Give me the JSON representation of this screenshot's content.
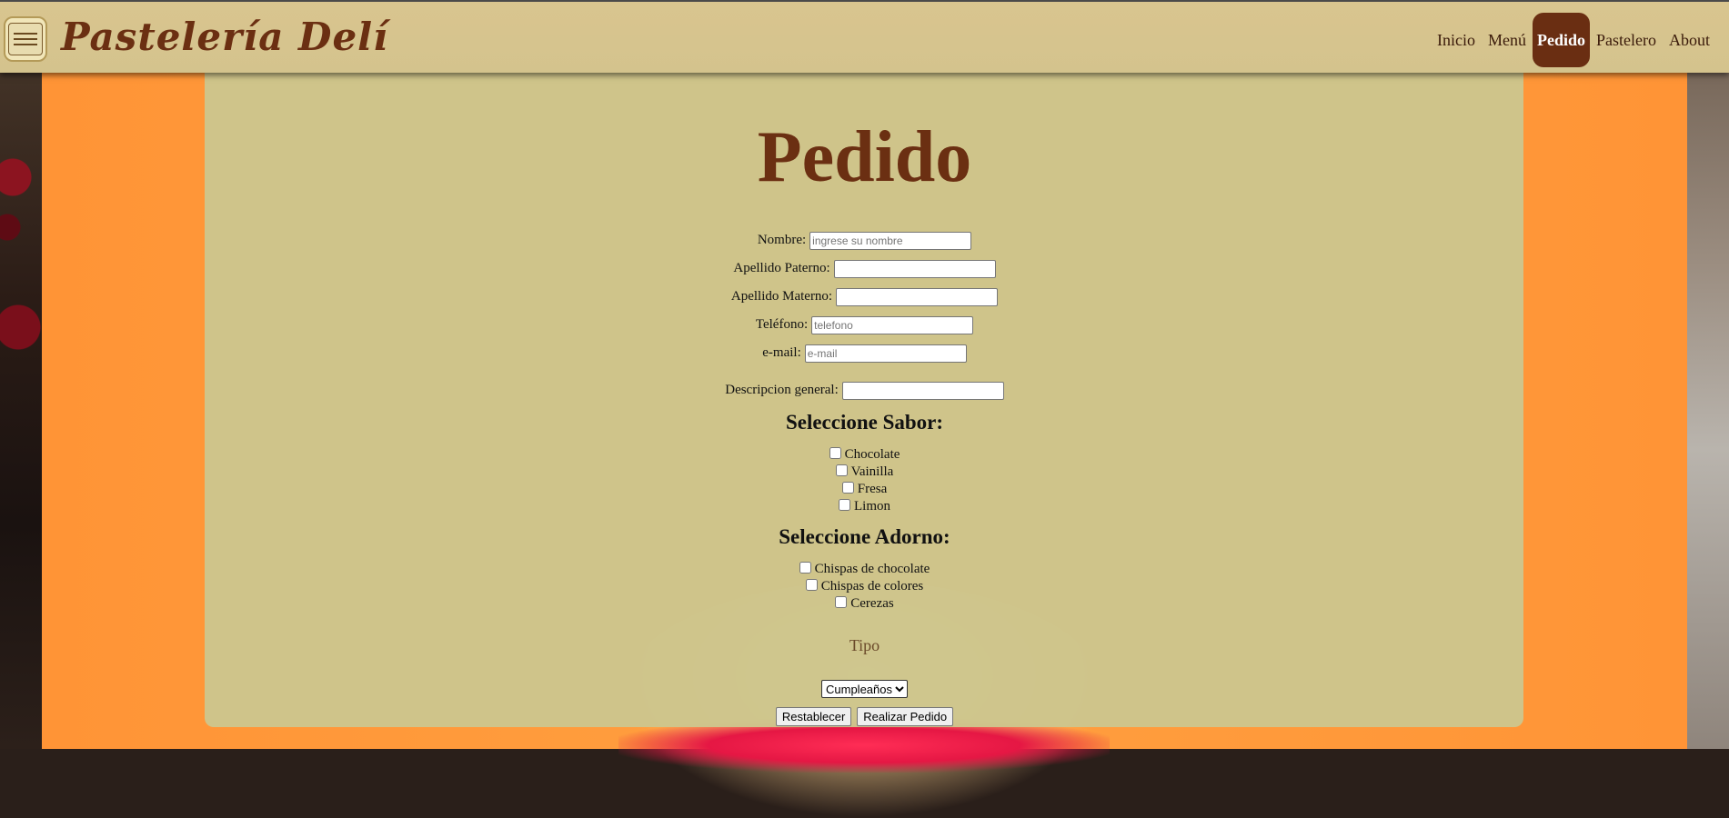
{
  "header": {
    "brand": "Pastelería Delí",
    "nav": [
      "Inicio",
      "Menú",
      "Pedido",
      "Pastelero",
      "About"
    ],
    "active": "Pedido"
  },
  "form": {
    "title": "Pedido",
    "fields": [
      {
        "label": "Nombre:",
        "placeholder": "ingrese su nombre",
        "value": ""
      },
      {
        "label": "Apellido Paterno:",
        "placeholder": "",
        "value": ""
      },
      {
        "label": "Apellido Materno:",
        "placeholder": "",
        "value": ""
      },
      {
        "label": "Teléfono:",
        "placeholder": "telefono",
        "value": ""
      },
      {
        "label": "e-mail:",
        "placeholder": "e-mail",
        "value": ""
      },
      {
        "label": "Descripcion general:",
        "placeholder": "",
        "value": ""
      }
    ],
    "sabor": {
      "heading": "Seleccione Sabor:",
      "options": [
        "Chocolate",
        "Vainilla",
        "Fresa",
        "Limon"
      ]
    },
    "adorno": {
      "heading": "Seleccione Adorno:",
      "options": [
        "Chispas de chocolate",
        "Chispas de colores",
        "Cerezas"
      ]
    },
    "tipo_label": "Tipo",
    "tipo_selected": "Cumpleaños",
    "reset_label": "Restablecer",
    "submit_label": "Realizar Pedido"
  }
}
